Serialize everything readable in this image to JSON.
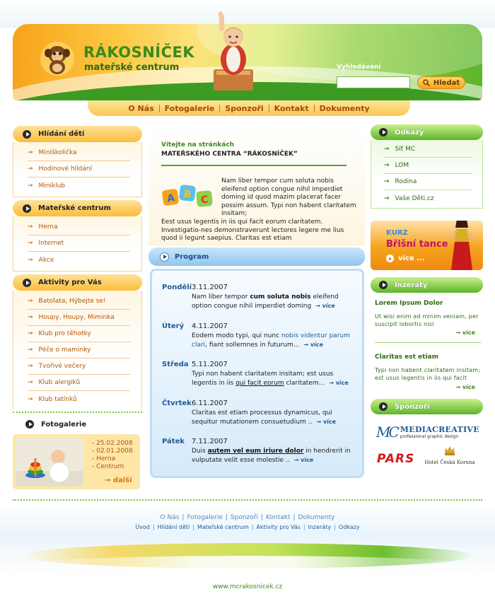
{
  "site": {
    "title": "RÁKOSNÍČEK",
    "subtitle": "mateřské centrum"
  },
  "search": {
    "label": "Vyhledávání",
    "value": "",
    "placeholder": "",
    "button_label": "Hledat"
  },
  "topnav": [
    "O Nás",
    "Fotogalerie",
    "Sponzoři",
    "Kontakt",
    "Dokumenty"
  ],
  "left": {
    "sections": [
      {
        "title": "Hlídání dětí",
        "items": [
          "Miniškolička",
          "Hodinové hlídání",
          "Miniklub"
        ]
      },
      {
        "title": "Mateřské centrum",
        "items": [
          "Herna",
          "Internet",
          "Akce"
        ]
      },
      {
        "title": "Aktivity pro Vás",
        "items": [
          "Batolata, Hýbejte se!",
          "Houpy, Houpy, Miminka",
          "Klub pro těhotky",
          "Péče o maminky",
          "Tvořivé večery",
          "Klub alergiků",
          "Klub tatínků"
        ]
      }
    ],
    "gallery": {
      "title": "Fotogalerie",
      "lines": [
        "- 25.02.2008",
        "- 02.01.2008",
        "- Herna",
        "- Centrum"
      ],
      "more": "další"
    }
  },
  "welcome": {
    "line1": "Vítejte na stránkách",
    "line2": "MATEŘSKÉHO CENTRA “RÁKOSNÍČEK”",
    "para1": "Nam liber tempor cum soluta nobis eleifend option congue nihil imperdiet doming id quod mazim placerat facer possim assum. Typi non habent claritatem insitam;",
    "para2": "Eest usus legentis in iis qui facit eorum claritatem. Investigatio-nes demonstraverunt lectores legere me lius quod ii legunt saepius. Claritas est etiam"
  },
  "program": {
    "title": "Program",
    "more_label": "více",
    "days": [
      {
        "name": "Pondělí",
        "date": "3.11.2007",
        "pre": "Nam liber tempor ",
        "bold": "cum soluta nobis",
        "post": " eleifend option congue nihil imperdiet doming"
      },
      {
        "name": "Úterý",
        "date": "4.11.2007",
        "pre": "Eodem modo typi, qui nunc ",
        "link": "nobis videntur parum clari",
        "post": ", fiant sollemnes in futurum..."
      },
      {
        "name": "Středa",
        "date": "5.11.2007",
        "pre": "Typi non habent claritatem insitam; est usus legentis in iis ",
        "under": "qui facit eorum",
        "post": " claritatem..."
      },
      {
        "name": "Čtvrtek",
        "date": "6.11.2007",
        "pre": "Claritas est etiam processus dynamicus, qui sequitur mutationem consuetudium ..",
        "post": ""
      },
      {
        "name": "Pátek",
        "date": "7.11.2007",
        "pre": "Duis ",
        "bold_under": "autem vel eum iriure dolor",
        "post": " in hendrerit in vulputate velit esse molestie .."
      }
    ]
  },
  "right": {
    "links_title": "Odkazy",
    "links": [
      "Síť MC",
      "LOM",
      "Rodina",
      "Vaše Děti.cz"
    ],
    "kurz": {
      "label": "KURZ",
      "title": "Břišní tance",
      "more": "více ..."
    },
    "ads_title": "Inzeráty",
    "ads": [
      {
        "title": "Lorem Ipsum Dolor",
        "body": "Ut wisi enim ad minim veniam, per suscipit lobortis nisl",
        "more": "více"
      },
      {
        "title": "Claritas est etiam",
        "body": "Typi non habent claritatem insitam; est usus legentis in iis qui facit",
        "more": "více"
      }
    ],
    "sponsors_title": "Sponzoři",
    "sponsors": {
      "mc_mark": "MC",
      "mc_name": "MEDIACREATIVE",
      "mc_sub": "professional graphic design",
      "pars": "PARS",
      "koruna": "Hotel Česká Koruna"
    }
  },
  "footer": {
    "nav1": [
      "O Nás",
      "Fotogalerie",
      "Sponzoři",
      "Kontakt",
      "Dokumenty"
    ],
    "nav2": [
      "Úvod",
      "Hlídání dětí",
      "Mateřské centrum",
      "Aktivity pro Vás",
      "Inzeráty",
      "Odkazy"
    ],
    "url": "www.mcrakosnicek.cz"
  },
  "colors": {
    "orange": "#f5a31c",
    "green": "#5cb52a",
    "blue": "#1f5a96"
  }
}
